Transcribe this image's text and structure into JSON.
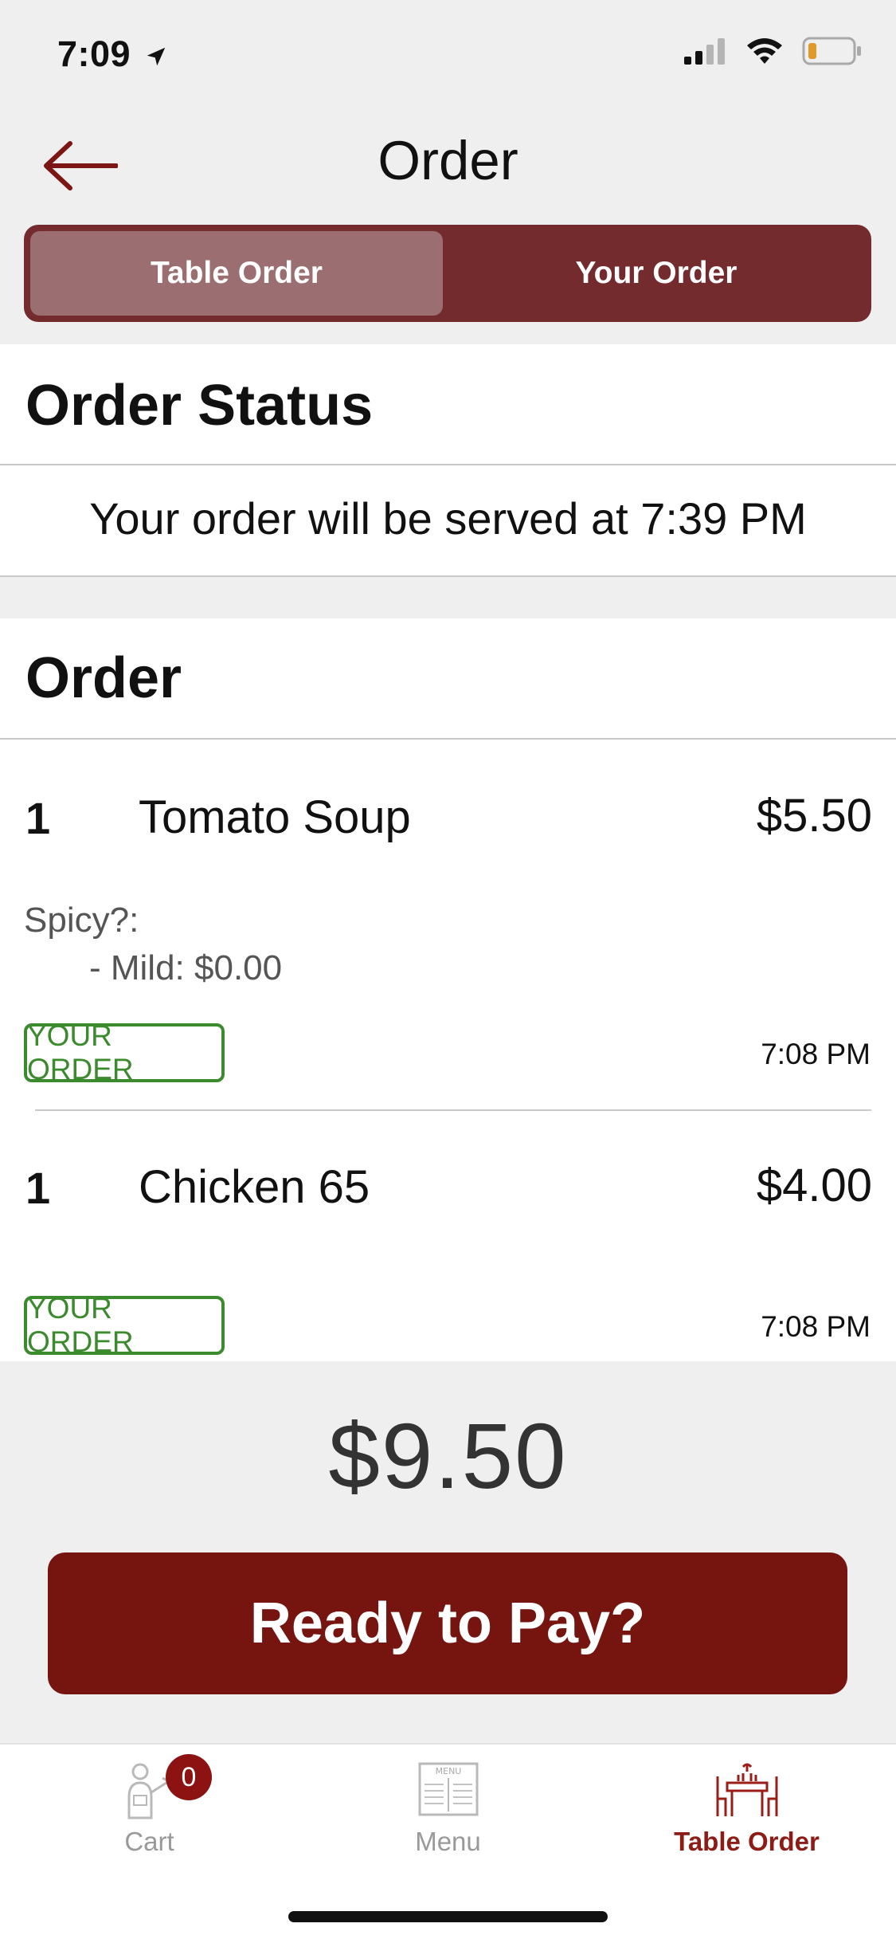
{
  "status_bar": {
    "time": "7:09"
  },
  "header": {
    "title": "Order"
  },
  "segments": [
    {
      "label": "Table Order",
      "active": true
    },
    {
      "label": "Your Order",
      "active": false
    }
  ],
  "order_status": {
    "title": "Order Status",
    "message": "Your order will be served at 7:39 PM"
  },
  "order": {
    "title": "Order",
    "items": [
      {
        "qty": "1",
        "name": "Tomato Soup",
        "price": "$5.50",
        "modifier_label": "Spicy?:",
        "modifier_option": "- Mild: $0.00",
        "badge": "YOUR ORDER",
        "time": "7:08 PM"
      },
      {
        "qty": "1",
        "name": "Chicken 65",
        "price": "$4.00",
        "badge": "YOUR ORDER",
        "time": "7:08 PM"
      }
    ]
  },
  "total": "$9.50",
  "pay_button": {
    "label": "Ready to Pay?"
  },
  "tabbar": {
    "cart": {
      "label": "Cart",
      "badge": "0"
    },
    "menu": {
      "label": "Menu",
      "icon_text": "MENU"
    },
    "table_order": {
      "label": "Table Order"
    }
  },
  "colors": {
    "brand": "#761410",
    "segment_bg": "#742b2e",
    "segment_active": "#9b6e71",
    "badge_green": "#3c8a2e"
  }
}
